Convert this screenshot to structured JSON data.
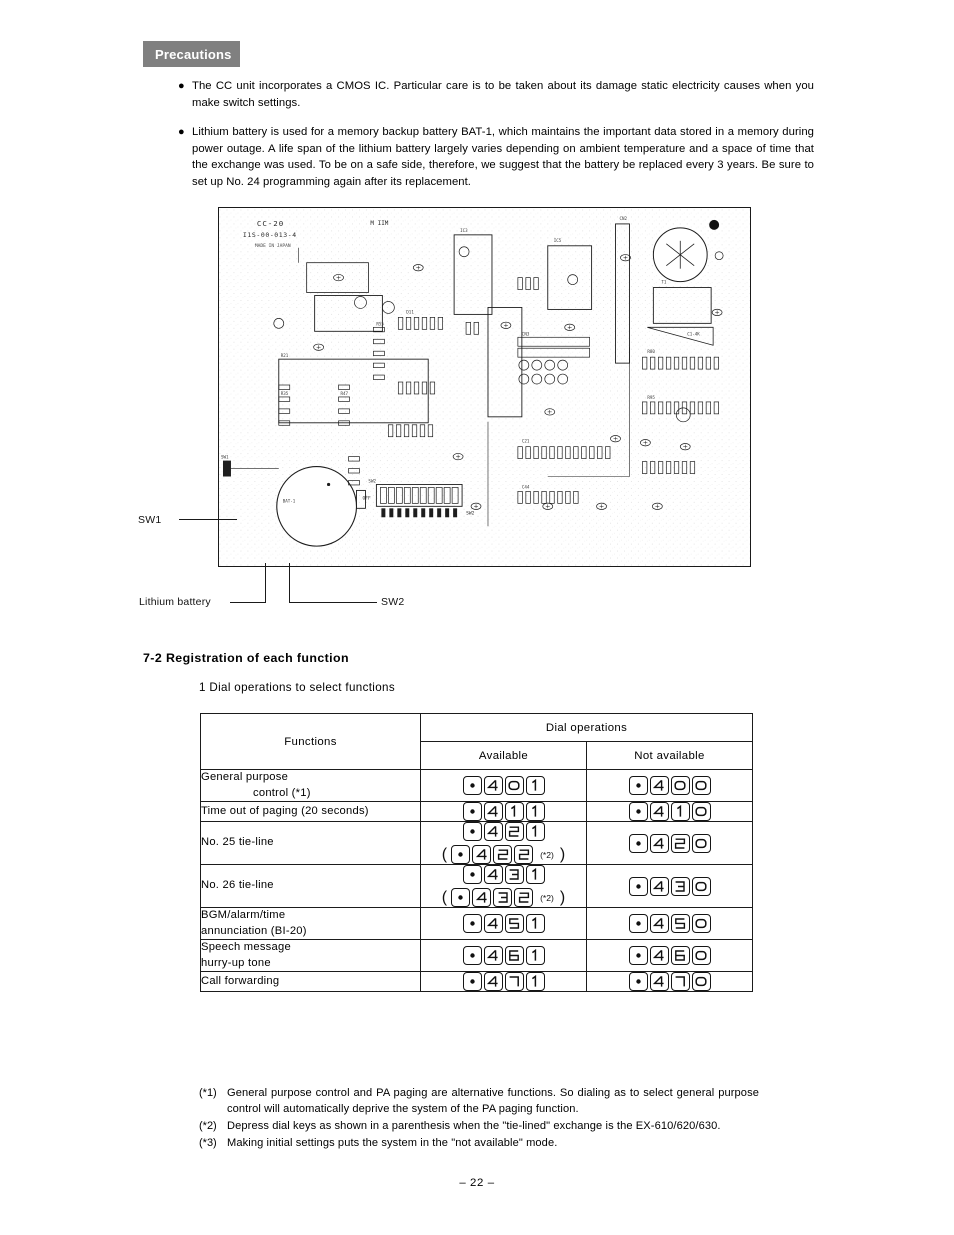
{
  "page": {
    "number_label": "– 22 –"
  },
  "precautions": {
    "badge_label": "Precautions",
    "items": [
      "The CC unit incorporates a CMOS IC. Particular care is to be taken about its damage static electricity causes when you make switch settings.",
      "Lithium battery is used for a memory backup battery BAT-1, which maintains the important data stored in a memory during power outage. A life span of the lithium battery largely varies depending on ambient temperature and a space of time that the exchange was used. To be on a safe side, therefore, we suggest that the battery be replaced every 3 years. Be sure to set up No. 24 programming again after its replacement."
    ]
  },
  "figure": {
    "callouts": {
      "sw1": "SW1",
      "lithium_battery": "Lithium battery",
      "sw2": "SW2"
    },
    "board_silkscreen": {
      "part_no": "CC-20",
      "code": "I1S-00-013-4"
    }
  },
  "section": {
    "heading": "7-2 Registration of each function",
    "subsection": "1  Dial operations to select functions"
  },
  "table": {
    "header": {
      "functions": "Functions",
      "dial_operations": "Dial operations",
      "available": "Available",
      "not_available": "Not available"
    },
    "rows": [
      {
        "function_line1": "General  purpose",
        "function_line2": "control  (*1)",
        "function_line2_indent": true,
        "available": [
          [
            "dot",
            "4",
            "0",
            "1"
          ]
        ],
        "available_note": null,
        "not_available": [
          [
            "dot",
            "4",
            "0",
            "0"
          ]
        ]
      },
      {
        "function_line1": "Time out of paging (20 seconds)",
        "function_line2": null,
        "function_line2_indent": false,
        "available": [
          [
            "dot",
            "4",
            "1",
            "1"
          ]
        ],
        "available_note": null,
        "not_available": [
          [
            "dot",
            "4",
            "1",
            "0"
          ]
        ]
      },
      {
        "function_line1": "No.  25  tie-line",
        "function_line2": null,
        "function_line2_indent": false,
        "available": [
          [
            "dot",
            "4",
            "2",
            "1"
          ]
        ],
        "available_paren": [
          "dot",
          "4",
          "2",
          "2"
        ],
        "available_note": "(*2)",
        "not_available": [
          [
            "dot",
            "4",
            "2",
            "0"
          ]
        ]
      },
      {
        "function_line1": "No.  26  tie-line",
        "function_line2": null,
        "function_line2_indent": false,
        "available": [
          [
            "dot",
            "4",
            "3",
            "1"
          ]
        ],
        "available_paren": [
          "dot",
          "4",
          "3",
          "2"
        ],
        "available_note": "(*2)",
        "not_available": [
          [
            "dot",
            "4",
            "3",
            "0"
          ]
        ]
      },
      {
        "function_line1": "BGM/alarm/time",
        "function_line2": "annunciation  (BI-20)",
        "function_line2_indent": false,
        "available": [
          [
            "dot",
            "4",
            "5",
            "1"
          ]
        ],
        "available_note": null,
        "not_available": [
          [
            "dot",
            "4",
            "5",
            "0"
          ]
        ]
      },
      {
        "function_line1": "Speech  message",
        "function_line2": "hurry-up  tone",
        "function_line2_indent": false,
        "available": [
          [
            "dot",
            "4",
            "6",
            "1"
          ]
        ],
        "available_note": null,
        "not_available": [
          [
            "dot",
            "4",
            "6",
            "0"
          ]
        ]
      },
      {
        "function_line1": "Call  forwarding",
        "function_line2": null,
        "function_line2_indent": false,
        "available": [
          [
            "dot",
            "4",
            "7",
            "1"
          ]
        ],
        "available_note": null,
        "not_available": [
          [
            "dot",
            "4",
            "7",
            "0"
          ]
        ]
      }
    ]
  },
  "footnotes": [
    {
      "mark": "(*1)",
      "text": "General purpose control and PA paging are alternative functions. So dialing as to select general purpose control will automatically deprive the system of the PA paging function."
    },
    {
      "mark": "(*2)",
      "text": "Depress dial keys as shown in a parenthesis when the \"tie-lined\" exchange is the EX-610/620/630."
    },
    {
      "mark": "(*3)",
      "text": "Making initial settings puts the system in the \"not available\" mode."
    }
  ]
}
